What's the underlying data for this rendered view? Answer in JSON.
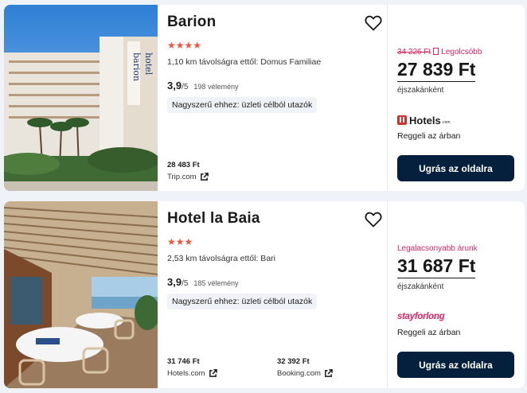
{
  "hotels": [
    {
      "name": "Barion",
      "stars": "★★★★",
      "distance": "1,10 km távolságra ettől: Domus Familiae",
      "rating": "3,9",
      "rating_max": "/5",
      "reviews": "198 vélemény",
      "tag": "Nagyszerű ehhez: üzleti célból utazók",
      "alt_prices": [
        {
          "price": "28 483 Ft",
          "site": "Trip.com"
        }
      ],
      "deal": {
        "old_price": "34 226 Ft",
        "badge": "Legolcsóbb",
        "price": "27 839 Ft",
        "per_night": "éjszakánként",
        "provider": "Hotels",
        "provider_suffix": ".com",
        "breakfast": "Reggeli az árban",
        "cta": "Ugrás az oldalra"
      }
    },
    {
      "name": "Hotel la Baia",
      "stars": "★★★",
      "distance": "2,53 km távolságra ettől: Bari",
      "rating": "3,9",
      "rating_max": "/5",
      "reviews": "185 vélemény",
      "tag": "Nagyszerű ehhez: üzleti célból utazók",
      "alt_prices": [
        {
          "price": "31 746 Ft",
          "site": "Hotels.com"
        },
        {
          "price": "32 392 Ft",
          "site": "Booking.com"
        }
      ],
      "deal": {
        "badge": "Legalacsonyabb árunk",
        "price": "31 687 Ft",
        "per_night": "éjszakánként",
        "provider": "stayforlong",
        "breakfast": "Reggeli az árban",
        "cta": "Ugrás az oldalra"
      }
    }
  ],
  "colors": {
    "accent_pink": "#e2245f",
    "star_orange": "#f0543c",
    "button_navy": "#05203c",
    "background": "#eff3f8"
  },
  "icons": [
    "heart-outline-icon",
    "external-link-icon",
    "hotels-com-logo",
    "stayforlong-logo"
  ]
}
